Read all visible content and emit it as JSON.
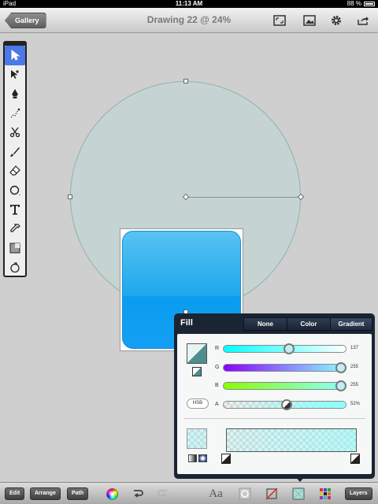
{
  "status": {
    "device": "iPad",
    "time": "11:13 AM",
    "battery": "88 %"
  },
  "nav": {
    "back_label": "Gallery",
    "title": "Drawing 22 @ 24%"
  },
  "fill_panel": {
    "title": "Fill",
    "tabs": [
      "None",
      "Color",
      "Gradient"
    ],
    "selected_tab": "Gradient",
    "channels": [
      {
        "label": "R",
        "value": "137",
        "fraction": 0.54
      },
      {
        "label": "G",
        "value": "255",
        "fraction": 1.0
      },
      {
        "label": "B",
        "value": "255",
        "fraction": 1.0
      },
      {
        "label": "A",
        "value": "52%",
        "fraction": 0.52
      }
    ],
    "hsb_label": "HSB",
    "colors": {
      "fill": "#89ffff",
      "accent": "#4c78e8"
    }
  },
  "bottom": {
    "edit": "Edit",
    "arrange": "Arrange",
    "path": "Path",
    "font": "Aa",
    "layers": "Layers"
  }
}
